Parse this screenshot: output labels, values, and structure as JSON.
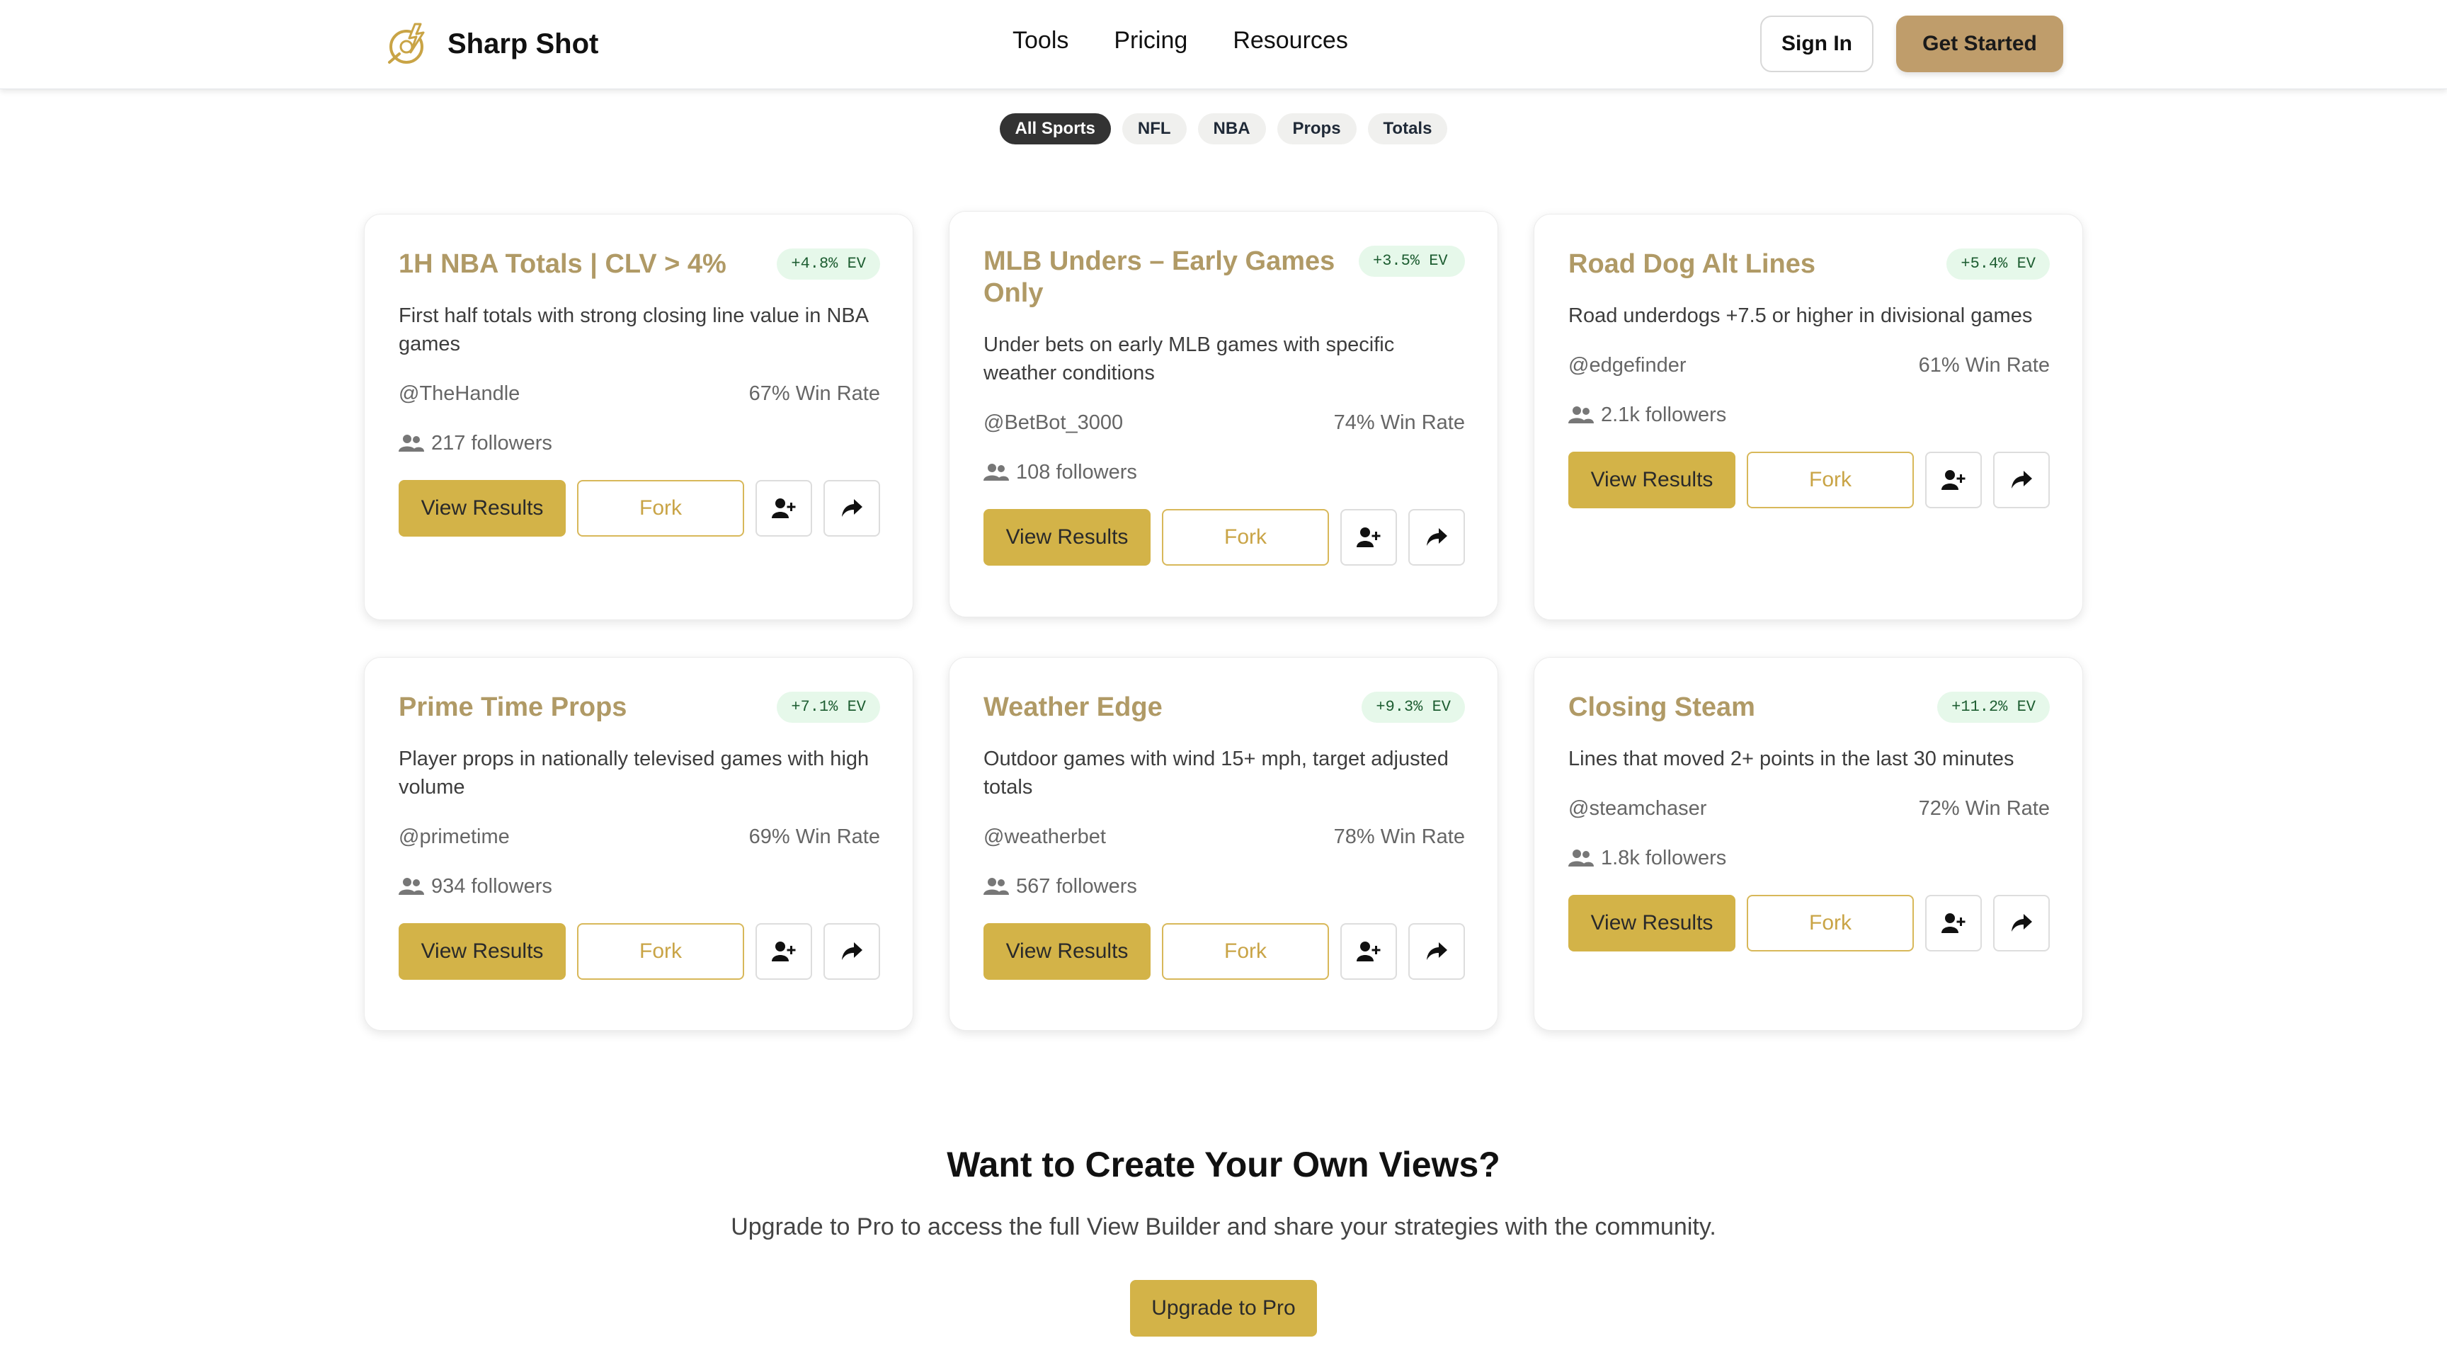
{
  "header": {
    "brand": "Sharp Shot",
    "nav": [
      "Tools",
      "Pricing",
      "Resources"
    ],
    "sign_in": "Sign In",
    "get_started": "Get Started"
  },
  "filters": {
    "items": [
      "All Sports",
      "NFL",
      "NBA",
      "Props",
      "Totals"
    ],
    "active": "All Sports"
  },
  "cards": [
    {
      "title": "1H NBA Totals | CLV > 4%",
      "ev": "+4.8% EV",
      "description": "First half totals with strong closing line value in NBA games",
      "author": "@TheHandle",
      "win_rate": "67% Win Rate",
      "followers": "217 followers",
      "view_label": "View Results",
      "fork_label": "Fork"
    },
    {
      "title": "MLB Unders – Early Games Only",
      "ev": "+3.5% EV",
      "description": "Under bets on early MLB games with specific weather conditions",
      "author": "@BetBot_3000",
      "win_rate": "74% Win Rate",
      "followers": "108 followers",
      "view_label": "View Results",
      "fork_label": "Fork"
    },
    {
      "title": "Road Dog Alt Lines",
      "ev": "+5.4% EV",
      "description": "Road underdogs +7.5 or higher in divisional games",
      "author": "@edgefinder",
      "win_rate": "61% Win Rate",
      "followers": "2.1k followers",
      "view_label": "View Results",
      "fork_label": "Fork"
    },
    {
      "title": "Prime Time Props",
      "ev": "+7.1% EV",
      "description": "Player props in nationally televised games with high volume",
      "author": "@primetime",
      "win_rate": "69% Win Rate",
      "followers": "934 followers",
      "view_label": "View Results",
      "fork_label": "Fork"
    },
    {
      "title": "Weather Edge",
      "ev": "+9.3% EV",
      "description": "Outdoor games with wind 15+ mph, target adjusted totals",
      "author": "@weatherbet",
      "win_rate": "78% Win Rate",
      "followers": "567 followers",
      "view_label": "View Results",
      "fork_label": "Fork"
    },
    {
      "title": "Closing Steam",
      "ev": "+11.2% EV",
      "description": "Lines that moved 2+ points in the last 30 minutes",
      "author": "@steamchaser",
      "win_rate": "72% Win Rate",
      "followers": "1.8k followers",
      "view_label": "View Results",
      "fork_label": "Fork"
    }
  ],
  "cta": {
    "title": "Want to Create Your Own Views?",
    "subtitle": "Upgrade to Pro to access the full View Builder and share your strategies with the community.",
    "button": "Upgrade to Pro"
  },
  "icons": {
    "brand": "crosshair-bolt-icon",
    "followers": "users-icon",
    "follow": "user-plus-icon",
    "share": "share-arrow-icon"
  },
  "colors": {
    "accent_gold": "#d3b348",
    "header_cta": "#bf9d6b",
    "card_title": "#b09a66",
    "ev_badge_bg": "#e6f8ea",
    "ev_badge_text": "#1d5d31",
    "active_pill": "#333333"
  }
}
